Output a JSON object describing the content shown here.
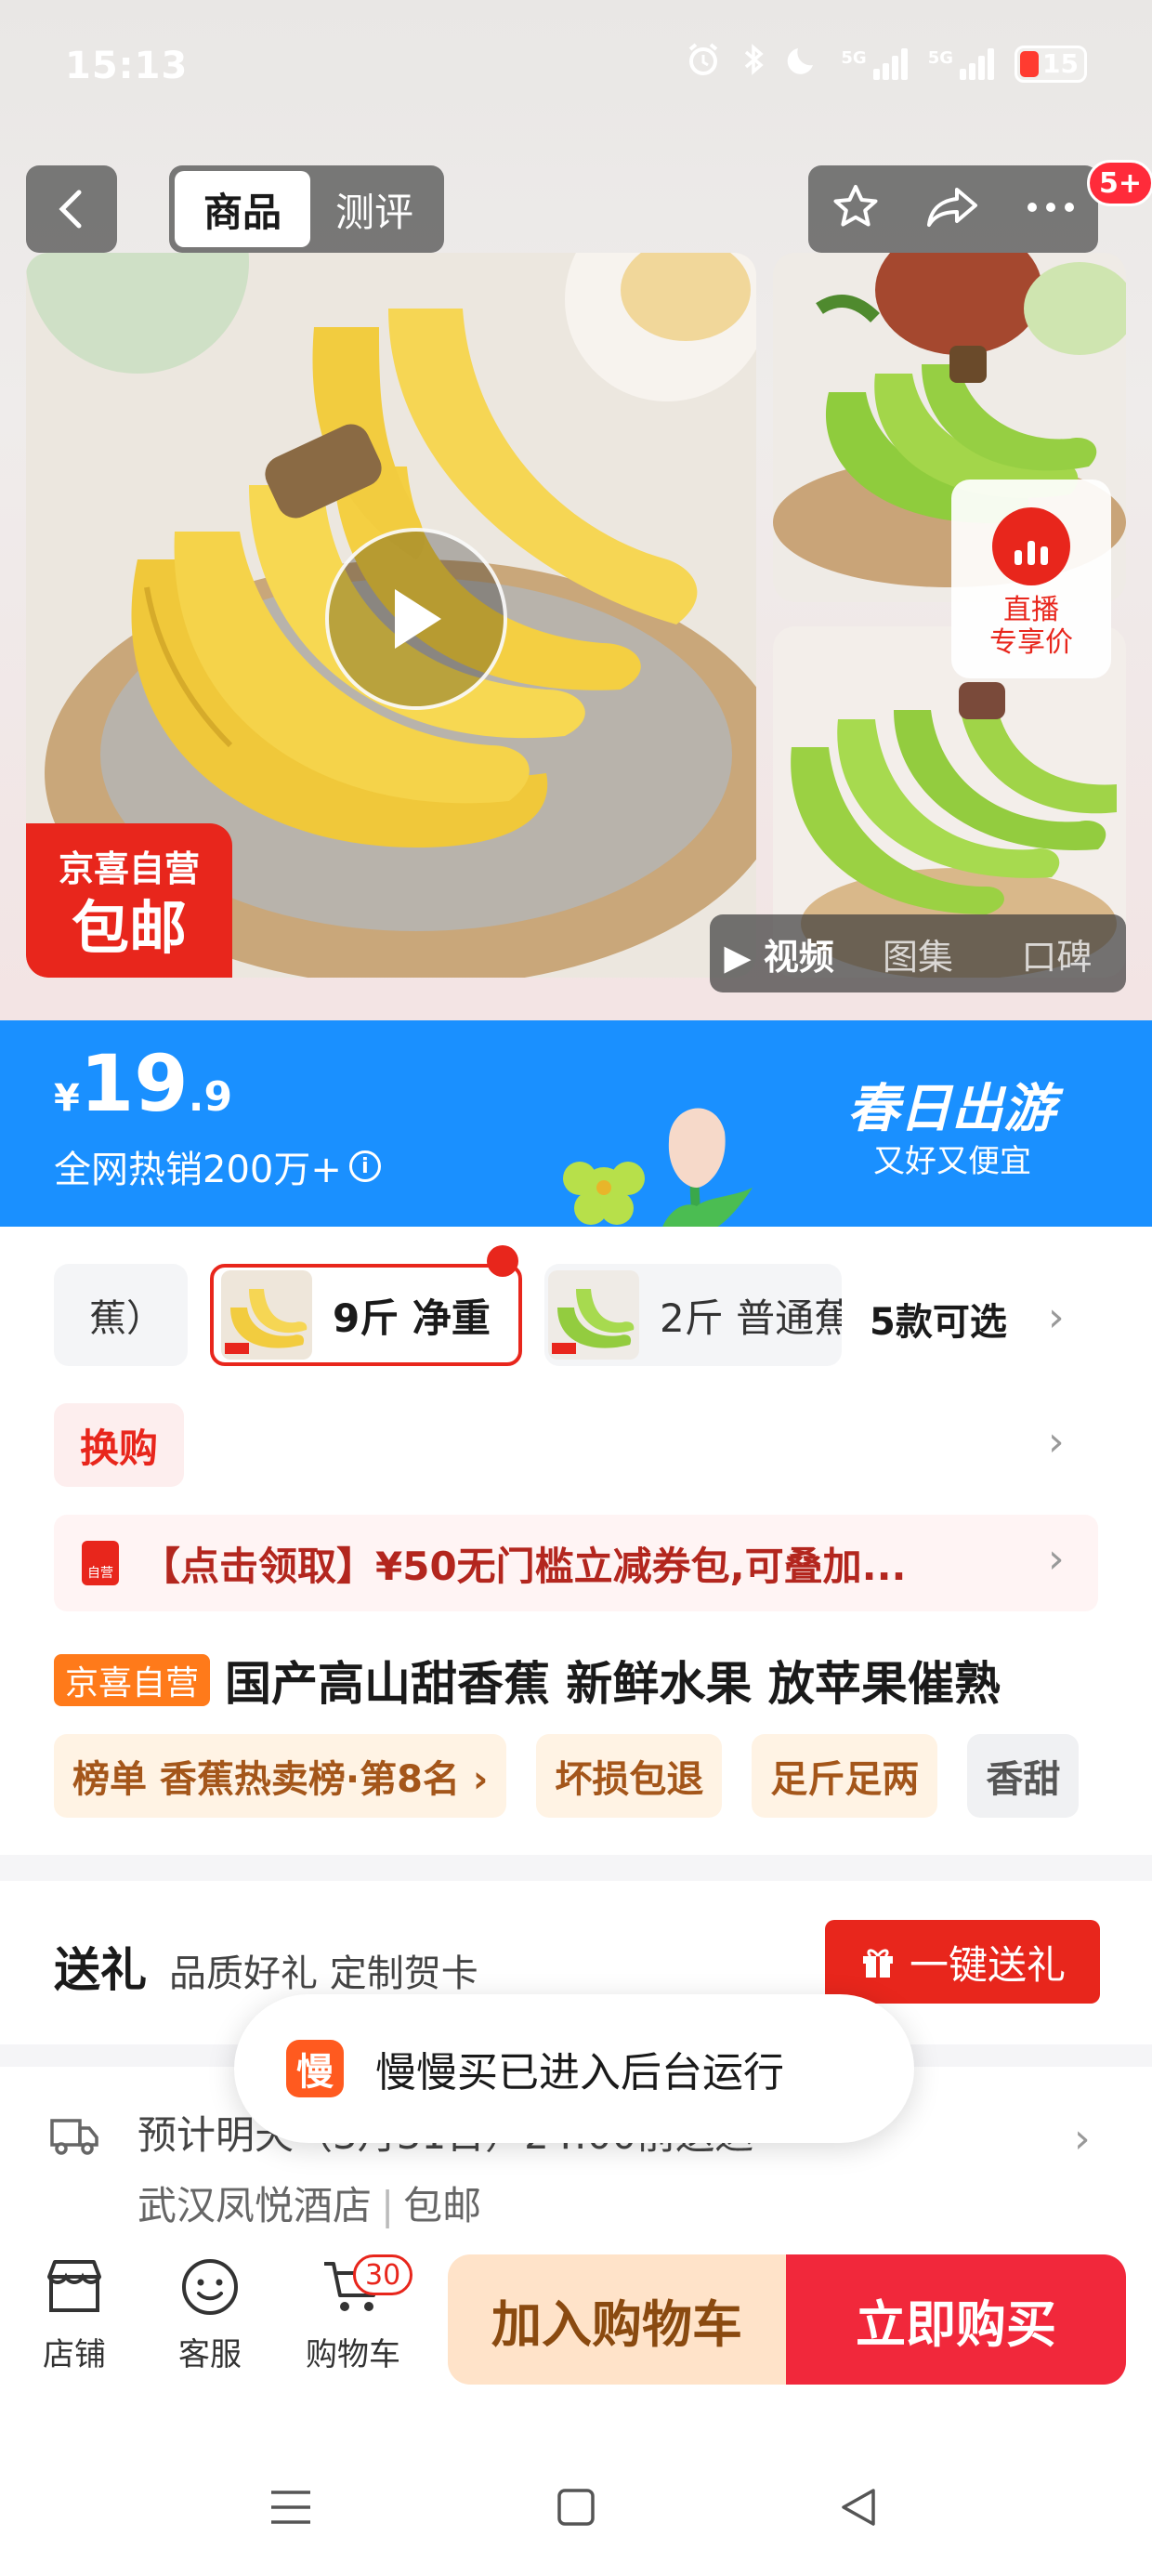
{
  "status_bar": {
    "time": "15:13",
    "net1": "5G",
    "net2": "5G",
    "battery": "15"
  },
  "top_nav": {
    "tab_goods": "商品",
    "tab_review": "测评",
    "more_badge": "5+"
  },
  "gallery": {
    "promo_line1": "京喜自营",
    "promo_line2": "包邮",
    "live_label": "直播\n专享价",
    "live_line1": "直播",
    "live_line2": "专享价",
    "media_tabs": [
      "视频",
      "图集",
      "口碑"
    ]
  },
  "price_banner": {
    "currency": "¥",
    "price_int": "19",
    "price_dec": ".9",
    "hot_sales": "全网热销200万+",
    "campaign_title": "春日出游",
    "campaign_sub": "又好又便宜"
  },
  "sku": {
    "item1": "蕉）",
    "item2": "9斤 净重",
    "item3": "2斤 普通蕉",
    "count": "5款可选"
  },
  "swap_label": "换购",
  "coupon": {
    "icon_text": "自营",
    "text": "【点击领取】¥50无门槛立减券包,可叠加..."
  },
  "product": {
    "badge": "京喜自营",
    "title": "国产高山甜香蕉  新鲜水果 放苹果催熟"
  },
  "tags": [
    {
      "label": "榜单 香蕉热卖榜·第8名 ›"
    },
    {
      "label": "坏损包退"
    },
    {
      "label": "足斤足两"
    },
    {
      "label": "香甜"
    }
  ],
  "gift": {
    "title": "送礼",
    "subtitle": "品质好礼 定制贺卡",
    "button": "一键送礼"
  },
  "delivery": {
    "line1": "预计明天（3月31日）24:00前送达",
    "address": "武汉凤悦酒店",
    "shipping": "包邮"
  },
  "toast": {
    "icon_text": "慢",
    "text": "慢慢买已进入后台运行"
  },
  "bottom_bar": {
    "shop": "店铺",
    "service": "客服",
    "cart": "购物车",
    "cart_count": "30",
    "add_cart": "加入购物车",
    "buy_now": "立即购买"
  },
  "colors": {
    "brand_red": "#e8261c",
    "banner_blue": "#1a90ff",
    "cart_bg": "#ffe3c9"
  }
}
